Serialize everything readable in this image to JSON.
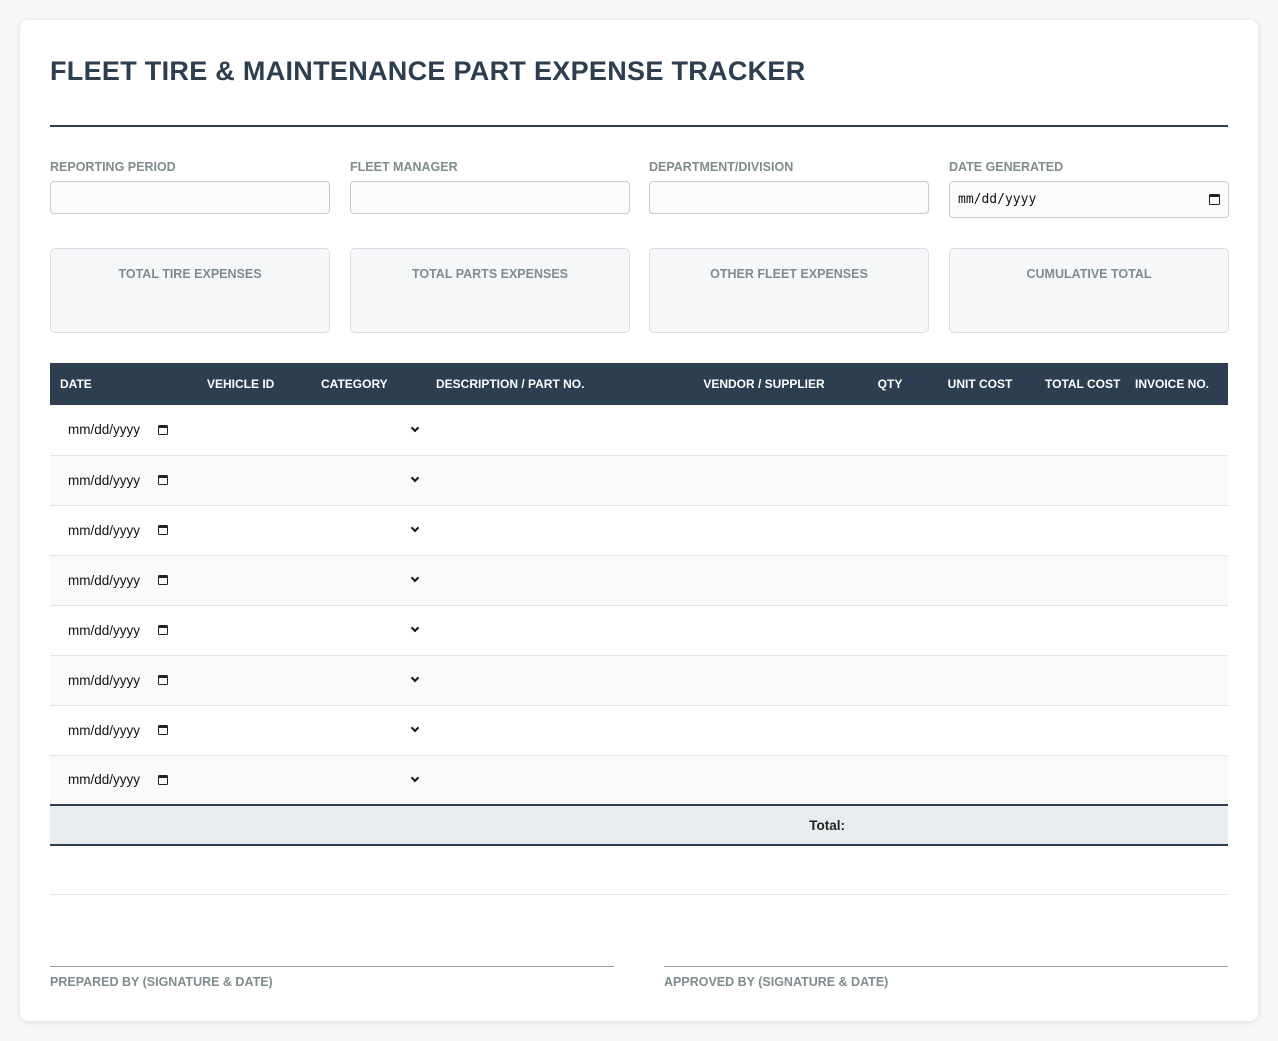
{
  "title": "FLEET TIRE & MAINTENANCE PART EXPENSE TRACKER",
  "fields": [
    {
      "label": "REPORTING PERIOD",
      "value": ""
    },
    {
      "label": "FLEET MANAGER",
      "value": ""
    },
    {
      "label": "DEPARTMENT/DIVISION",
      "value": ""
    },
    {
      "label": "DATE GENERATED",
      "value": "mm/dd/yyyy"
    }
  ],
  "summary": [
    {
      "label": "TOTAL TIRE EXPENSES",
      "value": ""
    },
    {
      "label": "TOTAL PARTS EXPENSES",
      "value": ""
    },
    {
      "label": "OTHER FLEET EXPENSES",
      "value": ""
    },
    {
      "label": "CUMULATIVE TOTAL",
      "value": ""
    }
  ],
  "table": {
    "columns": [
      "DATE",
      "VEHICLE ID",
      "CATEGORY",
      "DESCRIPTION / PART NO.",
      "VENDOR / SUPPLIER",
      "QTY",
      "UNIT COST",
      "TOTAL COST",
      "INVOICE NO."
    ],
    "rows": [
      {
        "date": "mm/dd/yyyy",
        "vehicle_id": "",
        "category": "",
        "description": "",
        "vendor": "",
        "qty": "",
        "unit_cost": "",
        "total_cost": "",
        "invoice": ""
      },
      {
        "date": "mm/dd/yyyy",
        "vehicle_id": "",
        "category": "",
        "description": "",
        "vendor": "",
        "qty": "",
        "unit_cost": "",
        "total_cost": "",
        "invoice": ""
      },
      {
        "date": "mm/dd/yyyy",
        "vehicle_id": "",
        "category": "",
        "description": "",
        "vendor": "",
        "qty": "",
        "unit_cost": "",
        "total_cost": "",
        "invoice": ""
      },
      {
        "date": "mm/dd/yyyy",
        "vehicle_id": "",
        "category": "",
        "description": "",
        "vendor": "",
        "qty": "",
        "unit_cost": "",
        "total_cost": "",
        "invoice": ""
      },
      {
        "date": "mm/dd/yyyy",
        "vehicle_id": "",
        "category": "",
        "description": "",
        "vendor": "",
        "qty": "",
        "unit_cost": "",
        "total_cost": "",
        "invoice": ""
      },
      {
        "date": "mm/dd/yyyy",
        "vehicle_id": "",
        "category": "",
        "description": "",
        "vendor": "",
        "qty": "",
        "unit_cost": "",
        "total_cost": "",
        "invoice": ""
      },
      {
        "date": "mm/dd/yyyy",
        "vehicle_id": "",
        "category": "",
        "description": "",
        "vendor": "",
        "qty": "",
        "unit_cost": "",
        "total_cost": "",
        "invoice": ""
      },
      {
        "date": "mm/dd/yyyy",
        "vehicle_id": "",
        "category": "",
        "description": "",
        "vendor": "",
        "qty": "",
        "unit_cost": "",
        "total_cost": "",
        "invoice": ""
      }
    ],
    "footer": {
      "total_label": "Total:",
      "total_value": ""
    }
  },
  "signatures": {
    "prepared": "PREPARED BY (SIGNATURE & DATE)",
    "approved": "APPROVED BY (SIGNATURE & DATE)"
  },
  "icons": {
    "date_picker": "calendar-icon",
    "select": "chevron-down-icon"
  },
  "colors": {
    "header_bg": "#2c3e50",
    "accent_text": "#2c3e50",
    "muted_label": "#7f8c8d"
  }
}
